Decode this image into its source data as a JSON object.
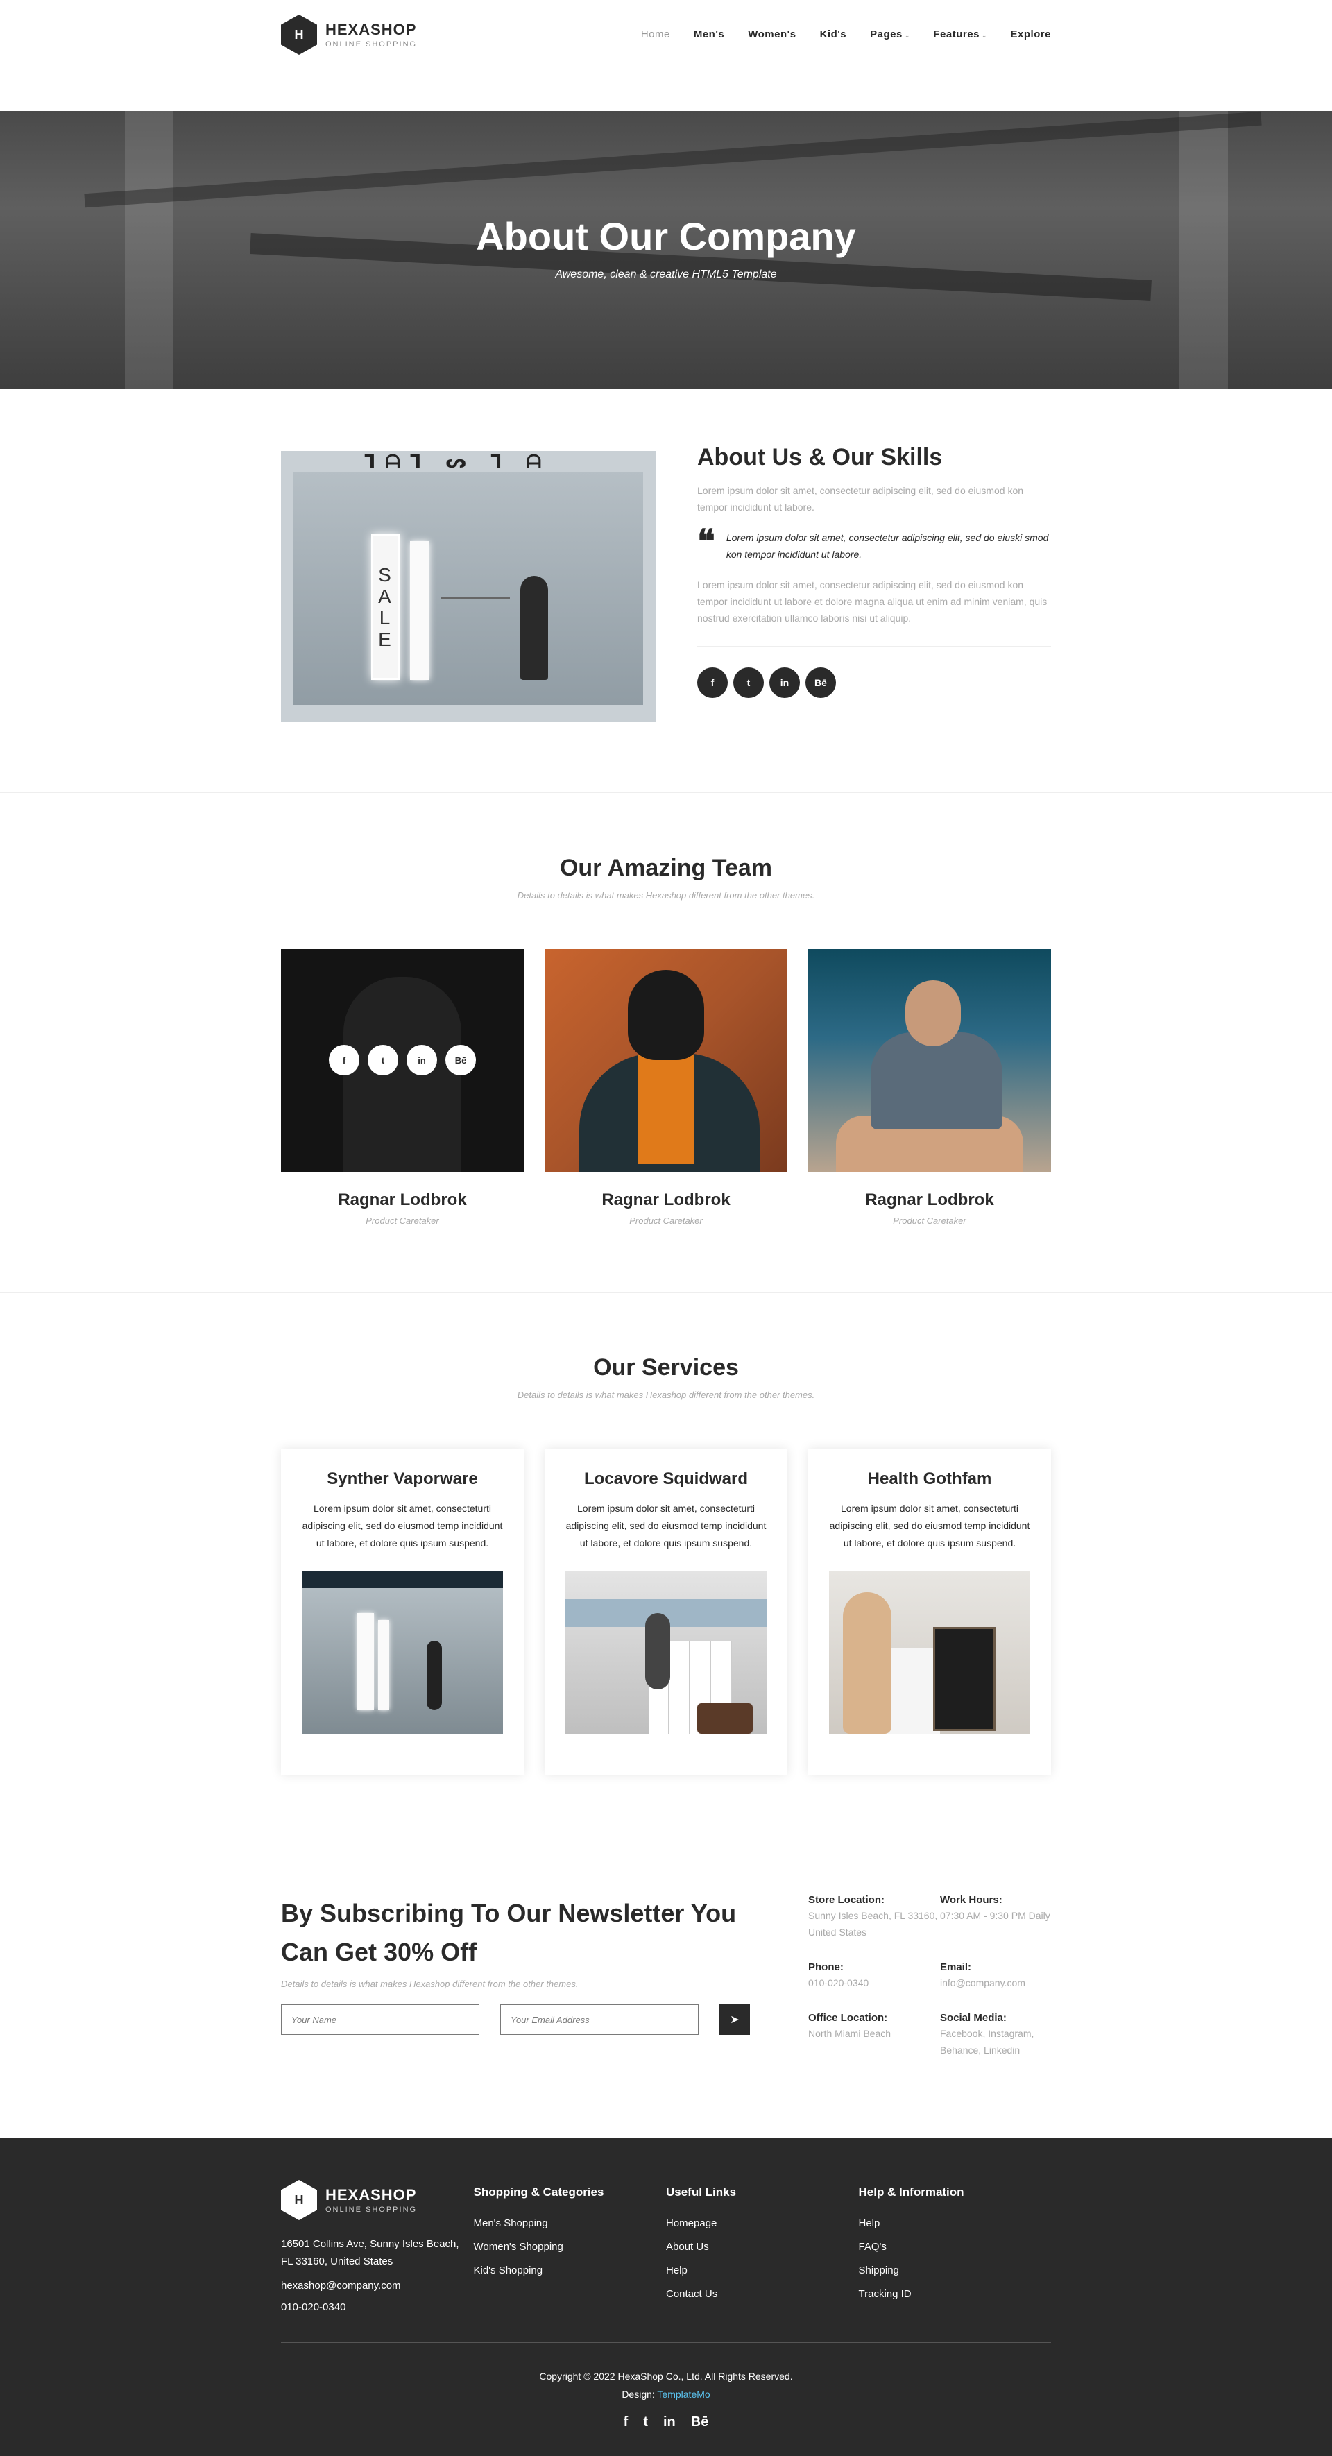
{
  "brand": {
    "name": "HEXASHOP",
    "tagline": "ONLINE SHOPPING",
    "mark": "H"
  },
  "nav": {
    "items": [
      "Home",
      "Men's",
      "Women's",
      "Kid's",
      "Pages",
      "Features",
      "Explore"
    ]
  },
  "hero": {
    "title": "About Our Company",
    "subtitle": "Awesome, clean & creative HTML5 Template"
  },
  "about": {
    "title": "About Us & Our Skills",
    "p1": "Lorem ipsum dolor sit amet, consectetur adipiscing elit, sed do eiusmod kon tempor incididunt ut labore.",
    "quote": "Lorem ipsum dolor sit amet, consectetur adipiscing elit, sed do eiuski smod kon tempor incididunt ut labore.",
    "p2": "Lorem ipsum dolor sit amet, consectetur adipiscing elit, sed do eiusmod kon tempor incididunt ut labore et dolore magna aliqua ut enim ad minim veniam, quis nostrud exercitation ullamco laboris nisi ut aliquip.",
    "image_sign": "SALE",
    "socials": [
      "f",
      "t",
      "in",
      "Bē"
    ]
  },
  "team": {
    "title": "Our Amazing Team",
    "subtitle": "Details to details is what makes Hexashop different from the other themes.",
    "members": [
      {
        "name": "Ragnar Lodbrok",
        "role": "Product Caretaker"
      },
      {
        "name": "Ragnar Lodbrok",
        "role": "Product Caretaker"
      },
      {
        "name": "Ragnar Lodbrok",
        "role": "Product Caretaker"
      }
    ],
    "hover_socials": [
      "f",
      "t",
      "in",
      "Bē"
    ]
  },
  "services": {
    "title": "Our Services",
    "subtitle": "Details to details is what makes Hexashop different from the other themes.",
    "items": [
      {
        "title": "Synther Vaporware",
        "text": "Lorem ipsum dolor sit amet, consecteturti adipiscing elit, sed do eiusmod temp incididunt ut labore, et dolore quis ipsum suspend."
      },
      {
        "title": "Locavore Squidward",
        "text": "Lorem ipsum dolor sit amet, consecteturti adipiscing elit, sed do eiusmod temp incididunt ut labore, et dolore quis ipsum suspend."
      },
      {
        "title": "Health Gothfam",
        "text": "Lorem ipsum dolor sit amet, consecteturti adipiscing elit, sed do eiusmod temp incididunt ut labore, et dolore quis ipsum suspend."
      }
    ]
  },
  "newsletter": {
    "title": "By Subscribing To Our Newsletter You Can Get 30% Off",
    "subtitle": "Details to details is what makes Hexashop different from the other themes.",
    "name_placeholder": "Your Name",
    "email_placeholder": "Your Email Address"
  },
  "contact": {
    "store_label": "Store Location:",
    "store_value": "Sunny Isles Beach, FL 33160, United States",
    "hours_label": "Work Hours:",
    "hours_value": "07:30 AM - 9:30 PM Daily",
    "phone_label": "Phone:",
    "phone_value": "010-020-0340",
    "email_label": "Email:",
    "email_value": "info@company.com",
    "office_label": "Office Location:",
    "office_value": "North Miami Beach",
    "social_label": "Social Media:",
    "social_value": "Facebook, Instagram, Behance, Linkedin"
  },
  "footer": {
    "address": "16501 Collins Ave, Sunny Isles Beach, FL 33160, United States",
    "email": "hexashop@company.com",
    "phone": "010-020-0340",
    "col1": {
      "title": "Shopping & Categories",
      "links": [
        "Men's Shopping",
        "Women's Shopping",
        "Kid's Shopping"
      ]
    },
    "col2": {
      "title": "Useful Links",
      "links": [
        "Homepage",
        "About Us",
        "Help",
        "Contact Us"
      ]
    },
    "col3": {
      "title": "Help & Information",
      "links": [
        "Help",
        "FAQ's",
        "Shipping",
        "Tracking ID"
      ]
    },
    "copyright": "Copyright © 2022 HexaShop Co., Ltd. All Rights Reserved.",
    "design_label": "Design:",
    "design_link": "TemplateMo",
    "socials": [
      "f",
      "t",
      "in",
      "Bē"
    ]
  },
  "colors": {
    "dark": "#2a2a2a",
    "muted": "#aaaaaa",
    "link": "#5bc4f0"
  }
}
